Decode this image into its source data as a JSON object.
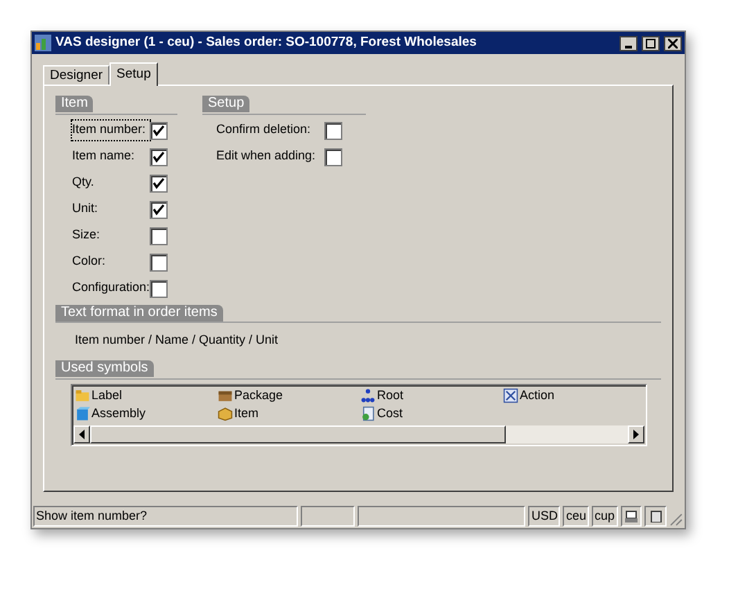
{
  "window": {
    "title": "VAS designer (1 - ceu) - Sales order: SO-100778, Forest Wholesales"
  },
  "tabs": [
    {
      "label": "Designer",
      "selected": false
    },
    {
      "label": "Setup",
      "selected": true
    }
  ],
  "item_group": {
    "title": "Item",
    "fields": [
      {
        "label": "Item number:",
        "checked": true,
        "focused": true
      },
      {
        "label": "Item name:",
        "checked": true,
        "focused": false
      },
      {
        "label": "Qty.",
        "checked": true,
        "focused": false
      },
      {
        "label": "Unit:",
        "checked": true,
        "focused": false
      },
      {
        "label": "Size:",
        "checked": false,
        "focused": false
      },
      {
        "label": "Color:",
        "checked": false,
        "focused": false
      },
      {
        "label": "Configuration:",
        "checked": false,
        "focused": false
      }
    ]
  },
  "setup_group": {
    "title": "Setup",
    "fields": [
      {
        "label": "Confirm deletion:",
        "checked": false
      },
      {
        "label": "Edit when adding:",
        "checked": false
      }
    ]
  },
  "text_format": {
    "title": "Text format in order items",
    "value": "Item number / Name / Quantity / Unit"
  },
  "used_symbols": {
    "title": "Used symbols",
    "items": [
      {
        "label": "Label"
      },
      {
        "label": "Package"
      },
      {
        "label": "Root"
      },
      {
        "label": "Action"
      },
      {
        "label": "Assembly"
      },
      {
        "label": "Item"
      },
      {
        "label": "Cost"
      }
    ]
  },
  "status_bar": {
    "message": "Show item number?",
    "panes": [
      "USD",
      "ceu",
      "cup"
    ]
  }
}
